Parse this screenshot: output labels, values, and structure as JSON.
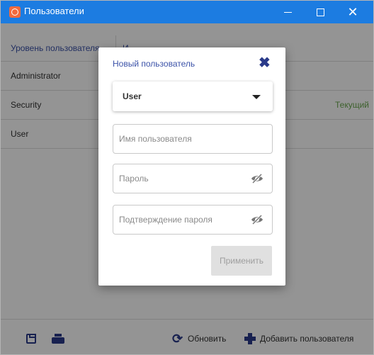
{
  "window": {
    "title": "Пользователи",
    "icons": {
      "app": "app-logo-icon",
      "minimize": "minimize-icon",
      "maximize": "maximize-icon",
      "close": "close-icon"
    },
    "close_glyph": "✕"
  },
  "table": {
    "headers": {
      "level": "Уровень пользователя",
      "name": "И"
    },
    "rows": [
      {
        "level": "Administrator",
        "status": ""
      },
      {
        "level": "Security",
        "status": "Текущий"
      },
      {
        "level": "User",
        "status": ""
      }
    ],
    "status_color": "#6aa84f",
    "header_color": "#3b52a8"
  },
  "footer": {
    "icons": {
      "save": "save-icon",
      "print": "print-icon",
      "refresh": "refresh-icon",
      "add": "plus-icon"
    },
    "refresh_label": "Обновить",
    "add_label": "Добавить пользователя"
  },
  "dialog": {
    "title": "Новый пользователь",
    "close_glyph": "✖",
    "role_select": {
      "value": "User",
      "icon": "caret-down-icon"
    },
    "username": {
      "value": "",
      "placeholder": "Имя пользователя"
    },
    "password": {
      "value": "",
      "placeholder": "Пароль",
      "icon": "eye-slash-icon"
    },
    "confirm_password": {
      "value": "",
      "placeholder": "Подтверждение пароля",
      "icon": "eye-slash-icon"
    },
    "apply_label": "Применить",
    "apply_enabled": false
  },
  "colors": {
    "titlebar": "#1c7ce1",
    "accent": "#2a3a8a",
    "overlay": "rgba(0,0,0,0.42)"
  }
}
